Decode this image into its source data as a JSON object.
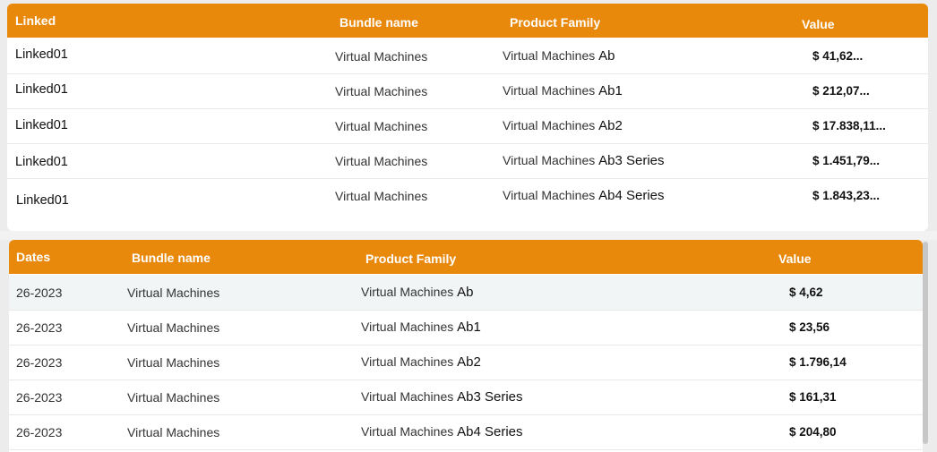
{
  "table_linked": {
    "headers": {
      "col1": "Linked",
      "col2": "Bundle name",
      "col3": "Product Family",
      "col4": "Value"
    },
    "rows": [
      {
        "linked": "Linked01",
        "bundle": "Virtual Machines",
        "pf_prefix": "Virtual Machines",
        "pf_suffix": "Ab",
        "value": "$ 41,62..."
      },
      {
        "linked": "Linked01",
        "bundle": "Virtual Machines",
        "pf_prefix": "Virtual Machines",
        "pf_suffix": "Ab1",
        "value": "$ 212,07..."
      },
      {
        "linked": "Linked01",
        "bundle": "Virtual Machines",
        "pf_prefix": "Virtual Machines",
        "pf_suffix": "Ab2",
        "value": "$ 17.838,11..."
      },
      {
        "linked": "Linked01",
        "bundle": "Virtual Machines",
        "pf_prefix": "Virtual Machines",
        "pf_suffix": "Ab3 Series",
        "value": "$ 1.451,79..."
      },
      {
        "linked": "Linked01",
        "bundle": "Virtual Machines",
        "pf_prefix": "Virtual Machines",
        "pf_suffix": "Ab4 Series",
        "value": "$ 1.843,23..."
      }
    ]
  },
  "table_dates": {
    "headers": {
      "col1": "Dates",
      "col2": "Bundle name",
      "col3": "Product Family",
      "col4": "Value"
    },
    "rows": [
      {
        "date": "26-2023",
        "bundle": "Virtual Machines",
        "pf_prefix": "Virtual Machines",
        "pf_suffix": "Ab",
        "value": "$ 4,62"
      },
      {
        "date": "26-2023",
        "bundle": "Virtual Machines",
        "pf_prefix": "Virtual Machines",
        "pf_suffix": "Ab1",
        "value": "$ 23,56"
      },
      {
        "date": "26-2023",
        "bundle": "Virtual Machines",
        "pf_prefix": "Virtual Machines",
        "pf_suffix": "Ab2",
        "value": "$ 1.796,14"
      },
      {
        "date": "26-2023",
        "bundle": "Virtual Machines",
        "pf_prefix": "Virtual Machines",
        "pf_suffix": "Ab3 Series",
        "value": "$ 161,31"
      },
      {
        "date": "26-2023",
        "bundle": "Virtual Machines",
        "pf_prefix": "Virtual Machines",
        "pf_suffix": "Ab4 Series",
        "value": "$ 204,80"
      }
    ]
  },
  "colors": {
    "header_bg": "#e8890c",
    "highlight_row": "#f2f5f5"
  }
}
